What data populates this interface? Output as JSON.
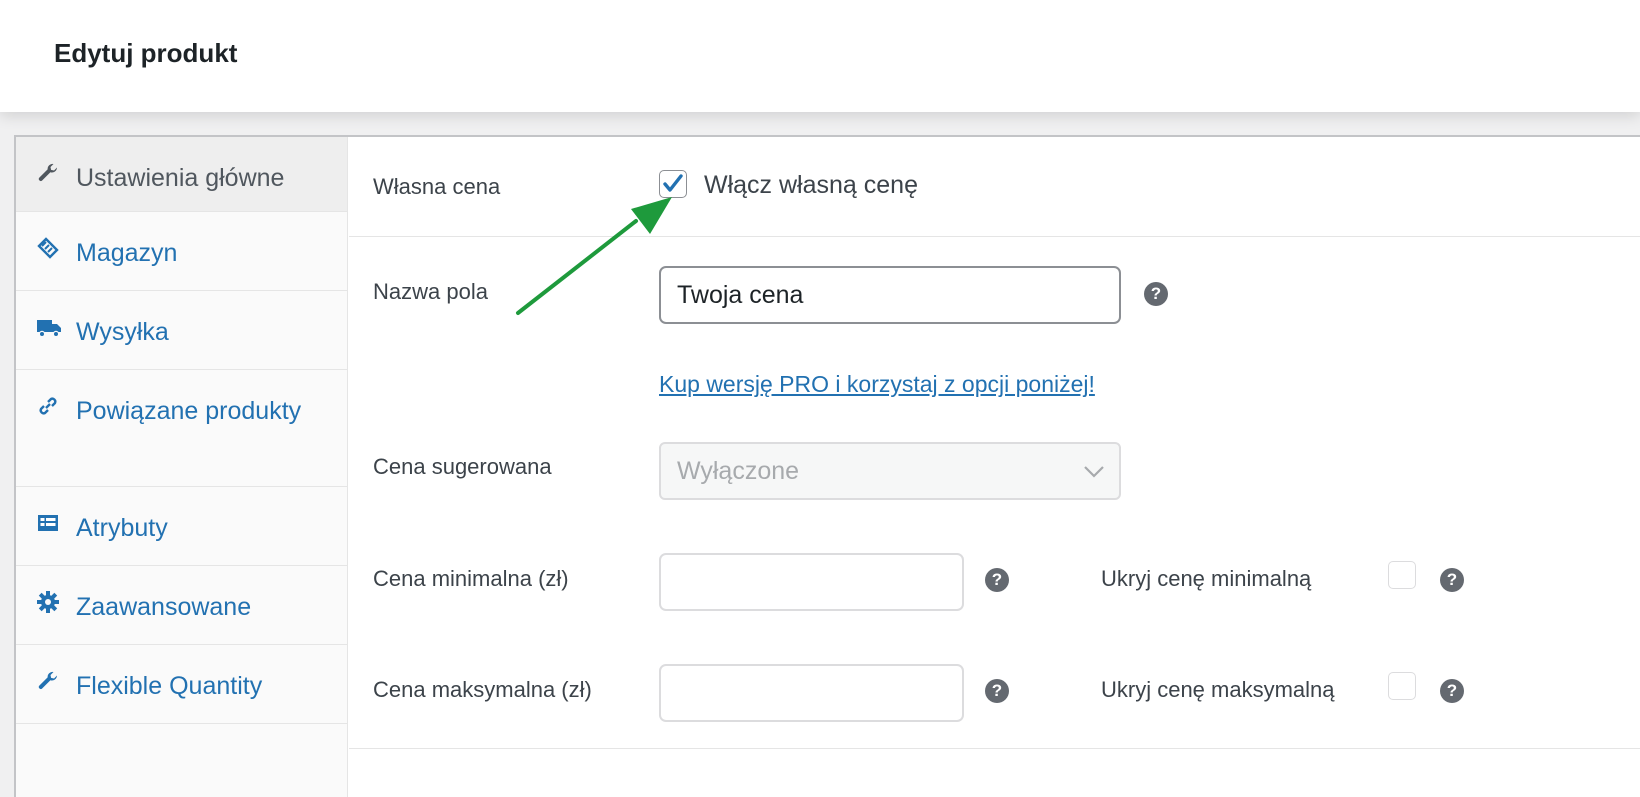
{
  "header": {
    "title": "Edytuj produkt"
  },
  "tabs": [
    {
      "label": "Ustawienia główne",
      "icon": "wrench-icon",
      "active": true
    },
    {
      "label": "Magazyn",
      "icon": "tag-icon"
    },
    {
      "label": "Wysyłka",
      "icon": "truck-icon"
    },
    {
      "label": "Powiązane produkty",
      "icon": "link-icon"
    },
    {
      "label": "Atrybuty",
      "icon": "list-table-icon"
    },
    {
      "label": "Zaawansowane",
      "icon": "gear-icon"
    },
    {
      "label": "Flexible Quantity",
      "icon": "wrench-icon"
    }
  ],
  "form": {
    "custom_price": {
      "label": "Własna cena",
      "checkbox_label": "Włącz własną cenę",
      "checked": true
    },
    "field_name": {
      "label": "Nazwa pola",
      "value": "Twoja cena",
      "help": "?"
    },
    "pro_link": "Kup wersję PRO i korzystaj z opcji poniżej!",
    "suggested_price": {
      "label": "Cena sugerowana",
      "selected": "Wyłączone"
    },
    "min_price": {
      "label": "Cena minimalna (zł)",
      "value": "",
      "hide_label": "Ukryj cenę minimalną",
      "help": "?"
    },
    "max_price": {
      "label": "Cena maksymalna (zł)",
      "value": "",
      "hide_label": "Ukryj cenę maksymalną",
      "help": "?"
    }
  },
  "colors": {
    "accent": "#2271b1",
    "arrow": "#1e9a3c",
    "check": "#2271b1"
  }
}
